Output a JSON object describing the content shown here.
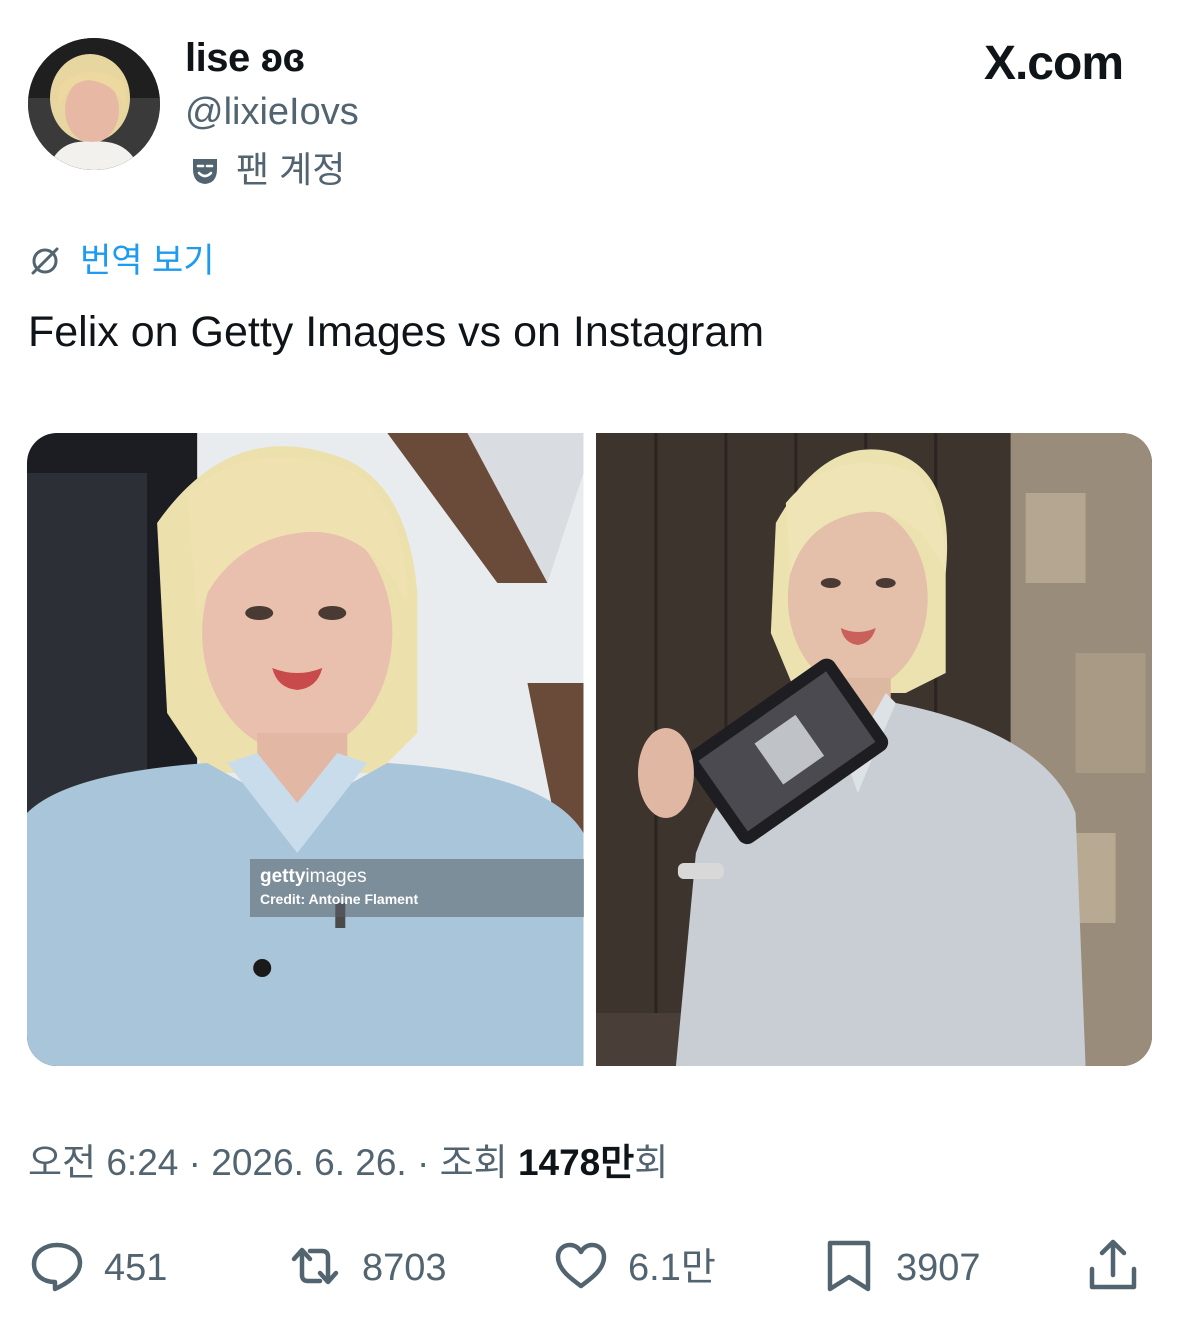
{
  "header": {
    "display_name": "lise ʚɞ",
    "handle": "@lixieIovs",
    "fan_label": "팬 계정",
    "brand": "X.com"
  },
  "tweet": {
    "translate_label": "번역 보기",
    "text": "Felix on Getty Images vs on Instagram"
  },
  "media": {
    "getty_logo_bold": "getty",
    "getty_logo_rest": "images",
    "getty_credit": "Credit: Antoine Flament"
  },
  "meta": {
    "time_date": "오전 6:24 · 2026. 6. 26. · 조회 ",
    "views_count": "1478만",
    "views_suffix": "회"
  },
  "actions": {
    "replies": "451",
    "reposts": "8703",
    "likes": "6.1만",
    "bookmarks": "3907"
  },
  "colors": {
    "accent": "#1d9bf0",
    "secondary_text": "#536471",
    "primary_text": "#0f1419"
  },
  "icons": [
    "fan-mask-icon",
    "translate-globe-icon",
    "reply-icon",
    "repost-icon",
    "like-icon",
    "bookmark-icon",
    "share-icon"
  ]
}
